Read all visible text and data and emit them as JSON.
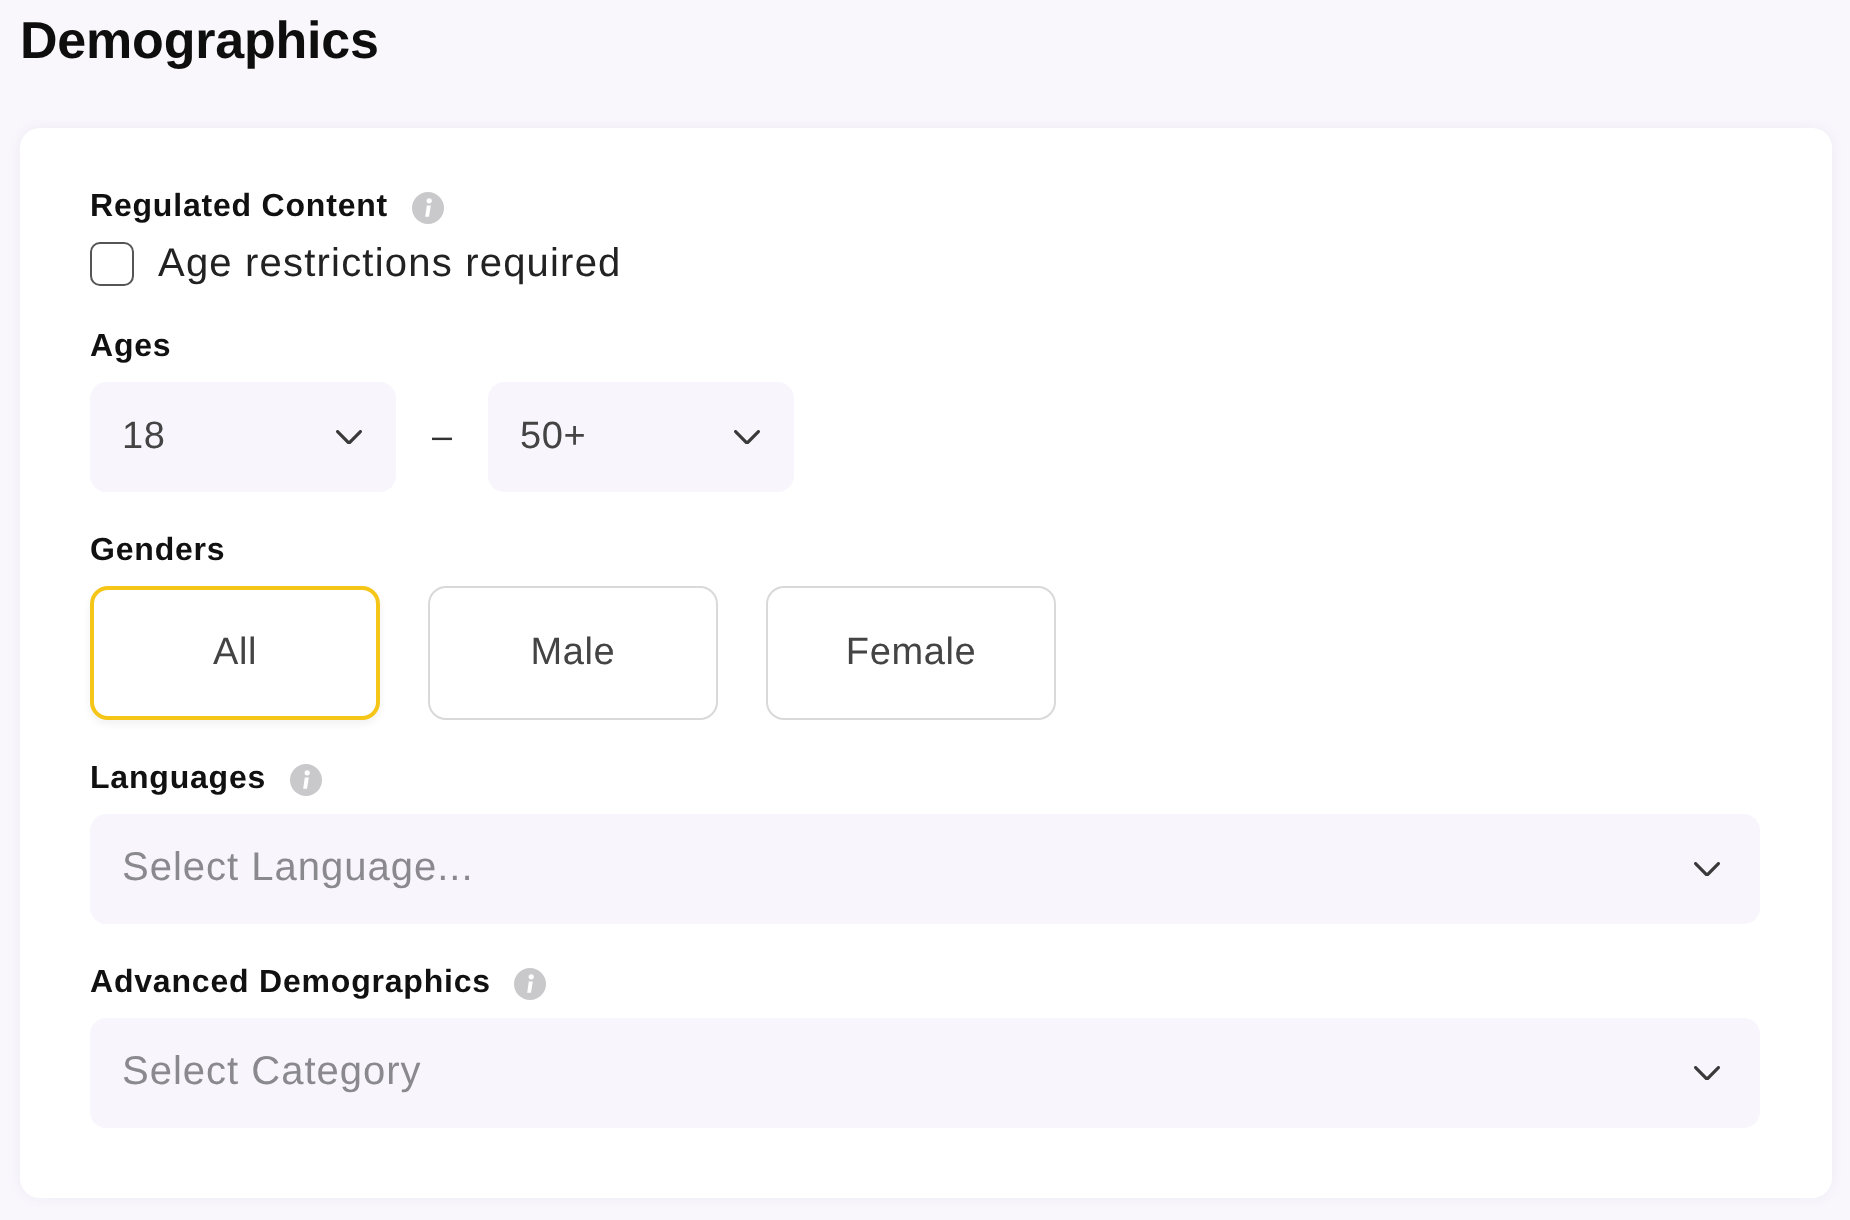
{
  "title": "Demographics",
  "sections": [
    {
      "kind": "checkbox",
      "label": "Regulated Content",
      "info_icon": true,
      "checkbox": {
        "label": "Age restrictions required",
        "checked": false
      }
    },
    {
      "kind": "range",
      "label": "Ages",
      "info_icon": false,
      "from": {
        "value": "18"
      },
      "separator": "–",
      "to": {
        "value": "50+"
      }
    },
    {
      "kind": "choice",
      "label": "Genders",
      "info_icon": false,
      "options": [
        {
          "label": "All",
          "selected": true
        },
        {
          "label": "Male",
          "selected": false
        },
        {
          "label": "Female",
          "selected": false
        }
      ]
    },
    {
      "kind": "dropdown",
      "label": "Languages",
      "info_icon": true,
      "placeholder": "Select Language..."
    },
    {
      "kind": "dropdown",
      "label": "Advanced Demographics",
      "info_icon": true,
      "placeholder": "Select Category"
    }
  ]
}
